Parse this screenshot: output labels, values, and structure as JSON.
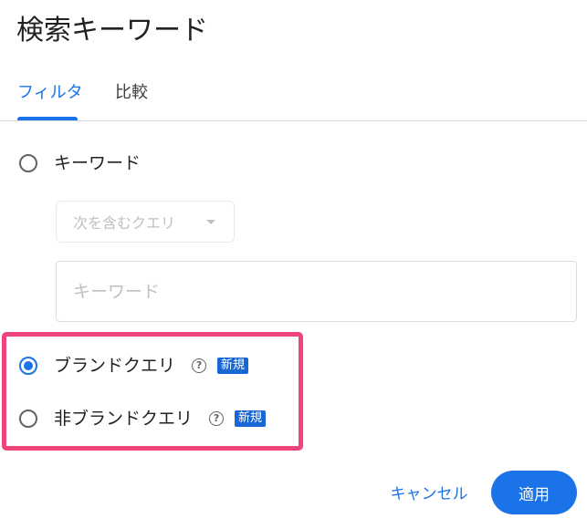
{
  "dialog": {
    "title": "検索キーワード"
  },
  "tabs": [
    {
      "label": "フィルタ",
      "active": true
    },
    {
      "label": "比較",
      "active": false
    }
  ],
  "options": {
    "keyword": {
      "label": "キーワード",
      "selected": false,
      "match_select": {
        "value": "次を含むクエリ"
      },
      "input": {
        "placeholder": "キーワード",
        "value": ""
      }
    },
    "brand": {
      "label": "ブランドクエリ",
      "selected": true,
      "badge": "新規",
      "help_icon": "help-circle-icon"
    },
    "nonbrand": {
      "label": "非ブランドクエリ",
      "selected": false,
      "badge": "新規",
      "help_icon": "help-circle-icon"
    }
  },
  "actions": {
    "cancel_label": "キャンセル",
    "apply_label": "適用"
  },
  "colors": {
    "accent": "#1a73e8",
    "badge": "#1967d2",
    "highlight": "#f0457a"
  }
}
